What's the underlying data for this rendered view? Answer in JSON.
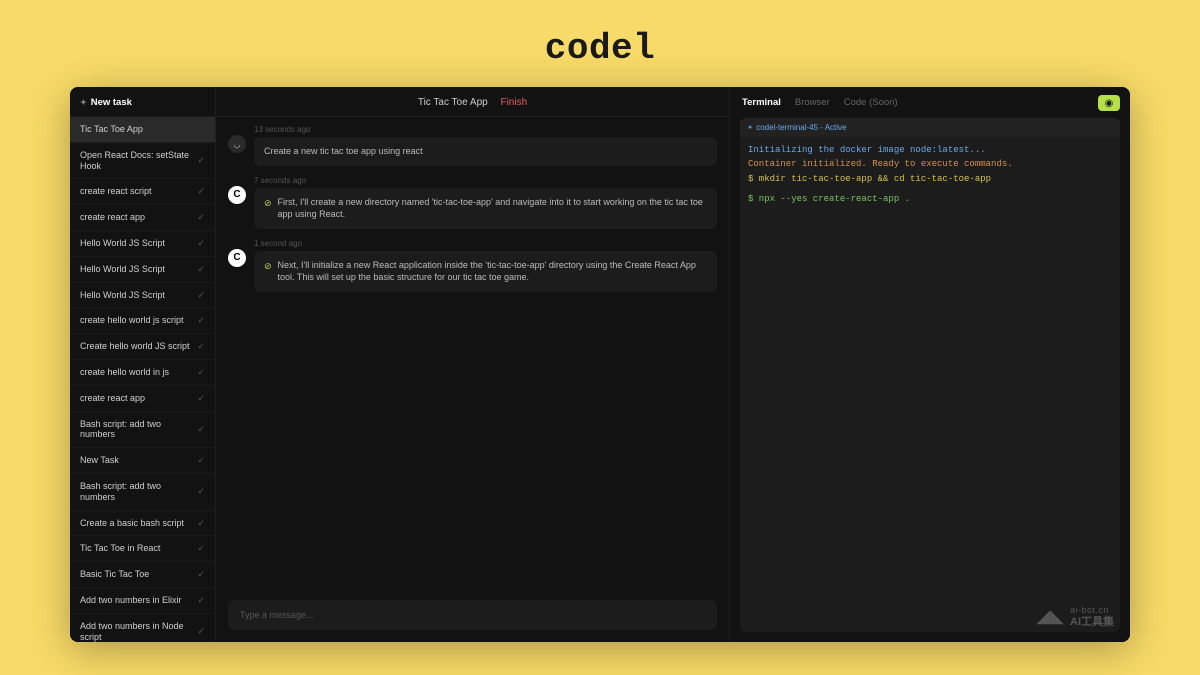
{
  "logo": "codel",
  "sidebar": {
    "header": "New task",
    "items": [
      {
        "label": "Tic Tac Toe App",
        "done": false,
        "active": true
      },
      {
        "label": "Open React Docs: setState Hook",
        "done": true
      },
      {
        "label": "create react script",
        "done": true
      },
      {
        "label": "create react app",
        "done": true
      },
      {
        "label": "Hello World JS Script",
        "done": true
      },
      {
        "label": "Hello World JS Script",
        "done": true
      },
      {
        "label": "Hello World JS Script",
        "done": true
      },
      {
        "label": "create hello world js script",
        "done": true
      },
      {
        "label": "Create hello world JS script",
        "done": true
      },
      {
        "label": "create hello world in js",
        "done": true
      },
      {
        "label": "create react app",
        "done": true
      },
      {
        "label": "Bash script: add two numbers",
        "done": true
      },
      {
        "label": "New Task",
        "done": true
      },
      {
        "label": "Bash script: add two numbers",
        "done": true
      },
      {
        "label": "Create a basic bash script",
        "done": true
      },
      {
        "label": "Tic Tac Toe in React",
        "done": true
      },
      {
        "label": "Basic Tic Tac Toe",
        "done": true
      },
      {
        "label": "Add two numbers in Elixir",
        "done": true
      },
      {
        "label": "Add two numbers in Node script",
        "done": true
      }
    ]
  },
  "chat": {
    "title": "Tic Tac Toe App",
    "status": "Finish",
    "messages": [
      {
        "role": "user",
        "time": "13 seconds ago",
        "text": "Create a new tic tac toe app using react"
      },
      {
        "role": "ai",
        "time": "7 seconds ago",
        "text": "First, I'll create a new directory named 'tic-tac-toe-app' and navigate into it to start working on the tic tac toe app using React."
      },
      {
        "role": "ai",
        "time": "1 second ago",
        "text": "Next, I'll initialize a new React application inside the 'tic-tac-toe-app' directory using the Create React App tool. This will set up the basic structure for our tic tac toe game."
      }
    ],
    "input_placeholder": "Type a message..."
  },
  "right": {
    "tabs": [
      "Terminal",
      "Browser",
      "Code (Soon)"
    ],
    "active_tab": 0,
    "terminal": {
      "title": "codel-terminal-45 - Active",
      "lines": [
        {
          "cls": "blue",
          "text": "Initializing the docker image node:latest..."
        },
        {
          "cls": "orange",
          "text": "Container initialized. Ready to execute commands."
        },
        {
          "cls": "yellow",
          "text": "$ mkdir tic-tac-toe-app && cd tic-tac-toe-app"
        },
        {
          "cls": "blank",
          "text": ""
        },
        {
          "cls": "green",
          "text": "$ npx --yes create-react-app ."
        }
      ]
    }
  },
  "watermark": {
    "url": "ai-bot.cn",
    "label": "AI工具集"
  }
}
